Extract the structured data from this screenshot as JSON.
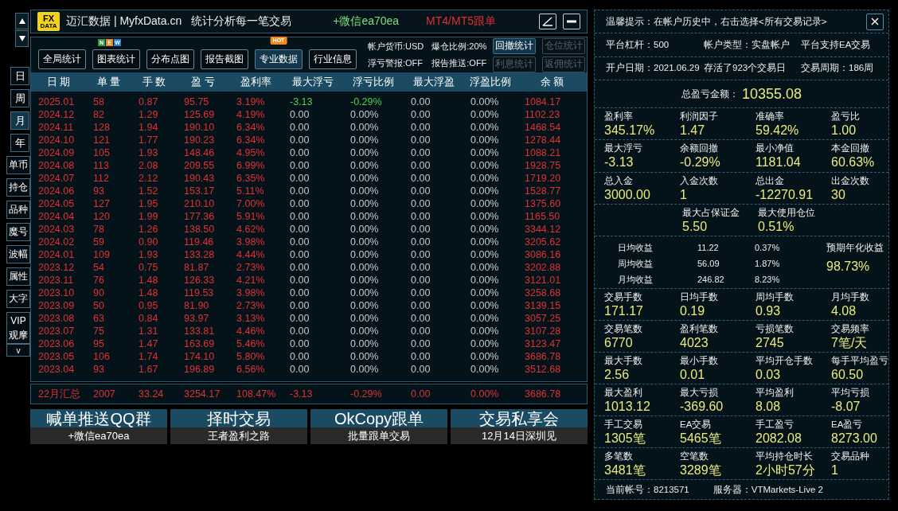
{
  "window": {
    "logo_top": "FX",
    "logo_bottom": "DATA",
    "title": "迈汇数据 | MyfxData.cn",
    "slogan": "统计分析每一笔交易",
    "contact": "+微信ea70ea",
    "promo": "MT4/MT5跟单"
  },
  "periods": [
    {
      "label": "日",
      "selected": false
    },
    {
      "label": "周",
      "selected": false
    },
    {
      "label": "月",
      "selected": true
    },
    {
      "label": "年",
      "selected": false
    }
  ],
  "tools": [
    {
      "label": "单币",
      "kind": "single"
    },
    {
      "label": "持仓",
      "kind": "single"
    },
    {
      "label": "品种",
      "kind": "single"
    },
    {
      "label": "魔号",
      "kind": "single"
    },
    {
      "label": "波幅",
      "kind": "single"
    },
    {
      "label": "属性",
      "kind": "single"
    },
    {
      "label": "大字",
      "kind": "single"
    },
    {
      "label": "VIP",
      "kind": "group-top"
    },
    {
      "label": "观摩",
      "kind": "group-bottom"
    },
    {
      "label": "v",
      "kind": "more"
    }
  ],
  "tabs": [
    {
      "label": "全局统计",
      "selected": false
    },
    {
      "label": "图表统计",
      "selected": false,
      "badge": {
        "kind": "letters",
        "letters": [
          {
            "text": "N",
            "color": "#2f9a3c"
          },
          {
            "text": "E",
            "color": "#e8861c"
          },
          {
            "text": "W",
            "color": "#1d7fd6"
          }
        ]
      }
    },
    {
      "label": "分布点图",
      "selected": false
    },
    {
      "label": "报告截图",
      "selected": false
    },
    {
      "label": "专业数据",
      "selected": true,
      "badge": {
        "kind": "hot",
        "text": "HOT"
      }
    },
    {
      "label": "行业信息",
      "selected": false
    }
  ],
  "account_info": [
    "帐户货币:USD",
    "爆仓比例:20%",
    "浮亏警报:OFF",
    "报告推送:OFF"
  ],
  "stat_buttons": [
    {
      "label": "回撤统计",
      "disabled": false
    },
    {
      "label": "仓位统计",
      "disabled": true
    },
    {
      "label": "利息统计",
      "disabled": true
    },
    {
      "label": "返佣统计",
      "disabled": true
    }
  ],
  "table": {
    "columns": [
      {
        "label": "日 期",
        "kind": "profit"
      },
      {
        "label": "单 量",
        "kind": "profit"
      },
      {
        "label": "手 数",
        "kind": "profit"
      },
      {
        "label": "盈 亏",
        "kind": "profit"
      },
      {
        "label": "盈利率",
        "kind": "profit"
      },
      {
        "label": "最大浮亏",
        "kind": "alert"
      },
      {
        "label": "浮亏比例",
        "kind": "alert"
      },
      {
        "label": "最大浮盈",
        "kind": "neutral"
      },
      {
        "label": "浮盈比例",
        "kind": "neutral"
      },
      {
        "label": "余 额",
        "kind": "profit"
      }
    ],
    "rows": [
      {
        "alert": true,
        "cells": [
          "2025.01",
          "58",
          "0.87",
          "95.75",
          "3.19%",
          "-3.13",
          "-0.29%",
          "0.00",
          "0.00%",
          "1084.17"
        ]
      },
      {
        "alert": false,
        "cells": [
          "2024.12",
          "82",
          "1.29",
          "125.69",
          "4.19%",
          "0.00",
          "0.00%",
          "0.00",
          "0.00%",
          "1102.23"
        ]
      },
      {
        "alert": false,
        "cells": [
          "2024.11",
          "128",
          "1.94",
          "190.10",
          "6.34%",
          "0.00",
          "0.00%",
          "0.00",
          "0.00%",
          "1468.54"
        ]
      },
      {
        "alert": false,
        "cells": [
          "2024.10",
          "121",
          "1.77",
          "190.23",
          "6.34%",
          "0.00",
          "0.00%",
          "0.00",
          "0.00%",
          "1278.44"
        ]
      },
      {
        "alert": false,
        "cells": [
          "2024.09",
          "105",
          "1.93",
          "148.46",
          "4.95%",
          "0.00",
          "0.00%",
          "0.00",
          "0.00%",
          "1088.21"
        ]
      },
      {
        "alert": false,
        "cells": [
          "2024.08",
          "113",
          "2.08",
          "209.55",
          "6.99%",
          "0.00",
          "0.00%",
          "0.00",
          "0.00%",
          "1928.75"
        ]
      },
      {
        "alert": false,
        "cells": [
          "2024.07",
          "112",
          "2.12",
          "190.43",
          "6.35%",
          "0.00",
          "0.00%",
          "0.00",
          "0.00%",
          "1719.20"
        ]
      },
      {
        "alert": false,
        "cells": [
          "2024.06",
          "93",
          "1.52",
          "153.17",
          "5.11%",
          "0.00",
          "0.00%",
          "0.00",
          "0.00%",
          "1528.77"
        ]
      },
      {
        "alert": false,
        "cells": [
          "2024.05",
          "127",
          "1.95",
          "210.10",
          "7.00%",
          "0.00",
          "0.00%",
          "0.00",
          "0.00%",
          "1375.60"
        ]
      },
      {
        "alert": false,
        "cells": [
          "2024.04",
          "120",
          "1.99",
          "177.36",
          "5.91%",
          "0.00",
          "0.00%",
          "0.00",
          "0.00%",
          "1165.50"
        ]
      },
      {
        "alert": false,
        "cells": [
          "2024.03",
          "78",
          "1.26",
          "138.50",
          "4.62%",
          "0.00",
          "0.00%",
          "0.00",
          "0.00%",
          "3344.12"
        ]
      },
      {
        "alert": false,
        "cells": [
          "2024.02",
          "59",
          "0.90",
          "119.46",
          "3.98%",
          "0.00",
          "0.00%",
          "0.00",
          "0.00%",
          "3205.62"
        ]
      },
      {
        "alert": false,
        "cells": [
          "2024.01",
          "109",
          "1.93",
          "133.28",
          "4.44%",
          "0.00",
          "0.00%",
          "0.00",
          "0.00%",
          "3086.16"
        ]
      },
      {
        "alert": false,
        "cells": [
          "2023.12",
          "54",
          "0.75",
          "81.87",
          "2.73%",
          "0.00",
          "0.00%",
          "0.00",
          "0.00%",
          "3202.88"
        ]
      },
      {
        "alert": false,
        "cells": [
          "2023.11",
          "76",
          "1.48",
          "126.33",
          "4.21%",
          "0.00",
          "0.00%",
          "0.00",
          "0.00%",
          "3121.01"
        ]
      },
      {
        "alert": false,
        "cells": [
          "2023.10",
          "90",
          "1.48",
          "119.53",
          "3.98%",
          "0.00",
          "0.00%",
          "0.00",
          "0.00%",
          "3258.68"
        ]
      },
      {
        "alert": false,
        "cells": [
          "2023.09",
          "50",
          "0.95",
          "81.90",
          "2.73%",
          "0.00",
          "0.00%",
          "0.00",
          "0.00%",
          "3139.15"
        ]
      },
      {
        "alert": false,
        "cells": [
          "2023.08",
          "63",
          "0.84",
          "93.97",
          "3.13%",
          "0.00",
          "0.00%",
          "0.00",
          "0.00%",
          "3057.25"
        ]
      },
      {
        "alert": false,
        "cells": [
          "2023.07",
          "75",
          "1.31",
          "133.81",
          "4.46%",
          "0.00",
          "0.00%",
          "0.00",
          "0.00%",
          "3107.28"
        ]
      },
      {
        "alert": false,
        "cells": [
          "2023.06",
          "95",
          "1.47",
          "163.69",
          "5.46%",
          "0.00",
          "0.00%",
          "0.00",
          "0.00%",
          "3123.47"
        ]
      },
      {
        "alert": false,
        "cells": [
          "2023.05",
          "106",
          "1.74",
          "174.10",
          "5.80%",
          "0.00",
          "0.00%",
          "0.00",
          "0.00%",
          "3686.78"
        ]
      },
      {
        "alert": false,
        "cells": [
          "2023.04",
          "93",
          "1.67",
          "196.89",
          "6.56%",
          "0.00",
          "0.00%",
          "0.00",
          "0.00%",
          "3512.68"
        ]
      }
    ],
    "summary": [
      "22月汇总",
      "2007",
      "33.24",
      "3254.17",
      "108.47%",
      "-3.13",
      "-0.29%",
      "0.00",
      "0.00%",
      "3686.78"
    ]
  },
  "banners": [
    {
      "title": "喊单推送QQ群",
      "subtitle": "+微信ea70ea"
    },
    {
      "title": "择时交易",
      "subtitle": "王者盈利之路"
    },
    {
      "title": "OkCopy跟单",
      "subtitle": "批量跟单交易"
    },
    {
      "title": "交易私享会",
      "subtitle": "12月14日深圳见"
    }
  ],
  "stats": {
    "notice": "温馨提示：在帐户历史中，右击选择<所有交易记录>",
    "account_lines": [
      [
        "平台杠杆：500",
        "帐户类型：实盘帐户",
        "平台支持EA交易"
      ],
      [
        "开户日期：2021.06.29",
        "存活了923个交易日",
        "交易周期：186周"
      ]
    ],
    "total": {
      "label": "总盈亏金额：",
      "value": "10355.08"
    },
    "groups_top": [
      {
        "kind": "full",
        "items": [
          {
            "label": "盈利率",
            "value": "345.17%"
          },
          {
            "label": "利润因子",
            "value": "1.47"
          },
          {
            "label": "准确率",
            "value": "59.42%"
          },
          {
            "label": "盈亏比",
            "value": "1.00"
          }
        ]
      },
      {
        "kind": "full",
        "items": [
          {
            "label": "最大浮亏",
            "value": "-3.13"
          },
          {
            "label": "余额回撤",
            "value": "-0.29%"
          },
          {
            "label": "最小净值",
            "value": "1181.04"
          },
          {
            "label": "本金回撤",
            "value": "60.63%"
          }
        ]
      },
      {
        "kind": "full",
        "items": [
          {
            "label": "总入金",
            "value": "3000.00"
          },
          {
            "label": "入金次数",
            "value": "1"
          },
          {
            "label": "总出金",
            "value": "-12270.91"
          },
          {
            "label": "出金次数",
            "value": "30"
          }
        ]
      },
      {
        "kind": "middle",
        "items": [
          {
            "label": "最大占保证金",
            "value": "5.50"
          },
          {
            "label": "最大使用仓位",
            "value": "0.51%"
          }
        ]
      }
    ],
    "averages": [
      {
        "label": "日均收益",
        "amount": "11.22",
        "percent": "0.37%"
      },
      {
        "label": "周均收益",
        "amount": "56.09",
        "percent": "1.87%"
      },
      {
        "label": "月均收益",
        "amount": "246.82",
        "percent": "8.23%"
      }
    ],
    "annual": {
      "label": "预期年化收益",
      "value": "98.73%"
    },
    "groups_bottom": [
      {
        "kind": "full",
        "items": [
          {
            "label": "交易手数",
            "value": "171.17"
          },
          {
            "label": "日均手数",
            "value": "0.19"
          },
          {
            "label": "周均手数",
            "value": "0.93"
          },
          {
            "label": "月均手数",
            "value": "4.08"
          }
        ]
      },
      {
        "kind": "full",
        "items": [
          {
            "label": "交易笔数",
            "value": "6770"
          },
          {
            "label": "盈利笔数",
            "value": "4023"
          },
          {
            "label": "亏损笔数",
            "value": "2745"
          },
          {
            "label": "交易频率",
            "value": "7笔/天"
          }
        ]
      },
      {
        "kind": "full",
        "items": [
          {
            "label": "最大手数",
            "value": "2.56"
          },
          {
            "label": "最小手数",
            "value": "0.01"
          },
          {
            "label": "平均开仓手数",
            "value": "0.03"
          },
          {
            "label": "每手平均盈亏",
            "value": "60.50"
          }
        ]
      },
      {
        "kind": "full",
        "items": [
          {
            "label": "最大盈利",
            "value": "1013.12"
          },
          {
            "label": "最大亏损",
            "value": "-369.60"
          },
          {
            "label": "平均盈利",
            "value": "8.08"
          },
          {
            "label": "平均亏损",
            "value": "-8.07"
          }
        ]
      },
      {
        "kind": "full",
        "items": [
          {
            "label": "手工交易",
            "value": "1305笔"
          },
          {
            "label": "EA交易",
            "value": "5465笔"
          },
          {
            "label": "手工盈亏",
            "value": "2082.08"
          },
          {
            "label": "EA盈亏",
            "value": "8273.00"
          }
        ]
      },
      {
        "kind": "full",
        "items": [
          {
            "label": "多笔数",
            "value": "3481笔"
          },
          {
            "label": "空笔数",
            "value": "3289笔"
          },
          {
            "label": "平均持仓时长",
            "value": "2小时57分"
          },
          {
            "label": "交易品种",
            "value": "1"
          }
        ]
      }
    ],
    "footer": [
      "当前帐号：8213571",
      "服务器：VTMarkets-Live 2"
    ]
  }
}
